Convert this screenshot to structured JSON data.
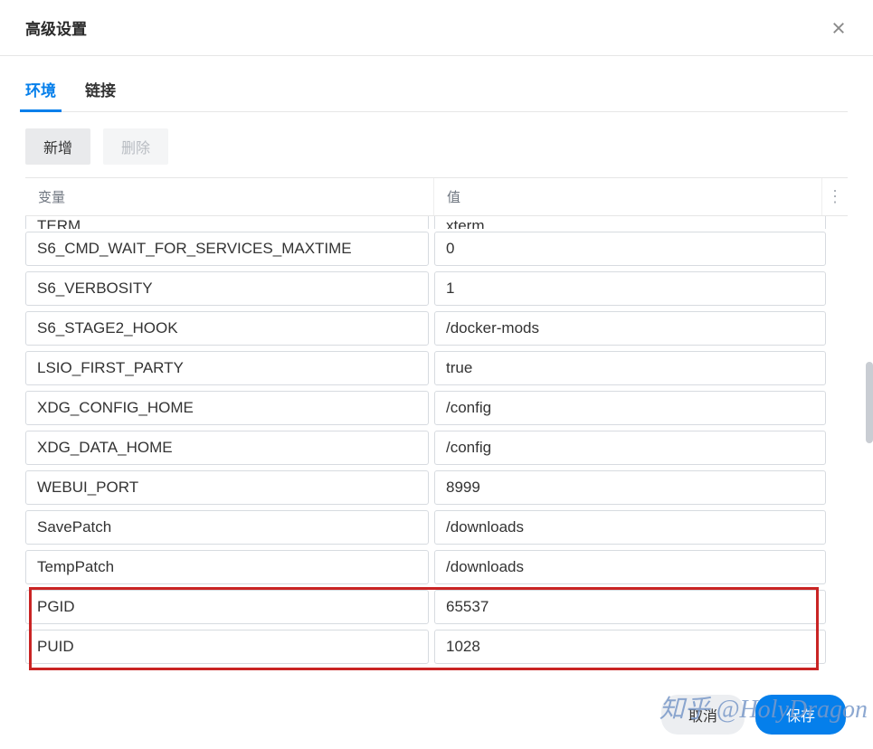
{
  "header": {
    "title": "高级设置"
  },
  "tabs": [
    {
      "label": "环境",
      "active": true
    },
    {
      "label": "链接",
      "active": false
    }
  ],
  "toolbar": {
    "add": "新增",
    "delete": "删除"
  },
  "columns": {
    "variable": "变量",
    "value": "值"
  },
  "env_rows": [
    {
      "variable": "TERM",
      "value": "xterm"
    },
    {
      "variable": "S6_CMD_WAIT_FOR_SERVICES_MAXTIME",
      "value": "0"
    },
    {
      "variable": "S6_VERBOSITY",
      "value": "1"
    },
    {
      "variable": "S6_STAGE2_HOOK",
      "value": "/docker-mods"
    },
    {
      "variable": "LSIO_FIRST_PARTY",
      "value": "true"
    },
    {
      "variable": "XDG_CONFIG_HOME",
      "value": "/config"
    },
    {
      "variable": "XDG_DATA_HOME",
      "value": "/config"
    },
    {
      "variable": "WEBUI_PORT",
      "value": "8999"
    },
    {
      "variable": "SavePatch",
      "value": "/downloads"
    },
    {
      "variable": "TempPatch",
      "value": "/downloads"
    },
    {
      "variable": "PGID",
      "value": "65537"
    },
    {
      "variable": "PUID",
      "value": "1028"
    }
  ],
  "footer": {
    "cancel": "取消",
    "save": "保存"
  },
  "watermark": "知乎 @HolyDragon"
}
